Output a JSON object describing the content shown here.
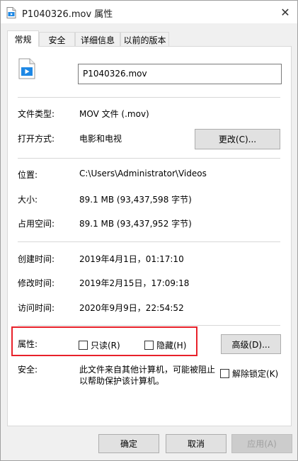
{
  "window": {
    "title": "P1040326.mov 属性",
    "close_glyph": "✕"
  },
  "tabs": [
    {
      "label": "常规",
      "active": true
    },
    {
      "label": "安全",
      "active": false
    },
    {
      "label": "详细信息",
      "active": false
    },
    {
      "label": "以前的版本",
      "active": false
    }
  ],
  "file": {
    "icon": "video-file-icon",
    "name": "P1040326.mov"
  },
  "general": {
    "type_label": "文件类型:",
    "type_value": "MOV 文件 (.mov)",
    "opens_with_label": "打开方式:",
    "opens_with_value": "电影和电视",
    "change_button": "更改(C)...",
    "location_label": "位置:",
    "location_value": "C:\\Users\\Administrator\\Videos",
    "size_label": "大小:",
    "size_value": "89.1 MB (93,437,598 字节)",
    "size_on_disk_label": "占用空间:",
    "size_on_disk_value": "89.1 MB (93,437,952 字节)",
    "created_label": "创建时间:",
    "created_value": "2019年4月1日，01:17:10",
    "modified_label": "修改时间:",
    "modified_value": "2019年2月15日，17:09:18",
    "accessed_label": "访问时间:",
    "accessed_value": "2020年9月9日，22:54:52",
    "attributes_label": "属性:",
    "readonly_label": "只读(R)",
    "hidden_label": "隐藏(H)",
    "advanced_button": "高级(D)...",
    "security_label": "安全:",
    "security_line1": "此文件来自其他计算机，可能被阻止",
    "security_line2": "以帮助保护该计算机。",
    "unblock_label": "解除锁定(K)"
  },
  "footer": {
    "ok": "确定",
    "cancel": "取消",
    "apply": "应用(A)"
  },
  "colors": {
    "highlight_border": "#e8212a",
    "icon_blue": "#1e88e5"
  }
}
